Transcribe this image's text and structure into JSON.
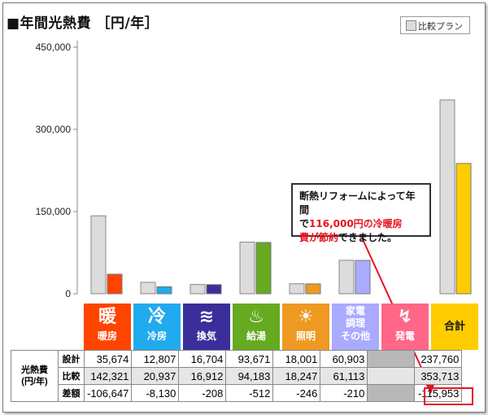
{
  "title": "■年間光熱費 ［円/年］",
  "legend": {
    "label": "比較プラン"
  },
  "chart_data": {
    "type": "bar",
    "title": "■年間光熱費 ［円/年］",
    "ylabel": "",
    "ylim": [
      0,
      450000
    ],
    "yticks": [
      "450,000",
      "300,000",
      "150,000",
      "0"
    ],
    "ytick_values": [
      450000,
      300000,
      150000,
      0
    ],
    "categories": [
      "暖房",
      "冷房",
      "換気",
      "給湯",
      "照明",
      "家電調理その他",
      "発電",
      "合計"
    ],
    "series": [
      {
        "name": "比較プラン",
        "values": [
          142321,
          20937,
          16912,
          94183,
          18247,
          61113,
          0,
          353713
        ]
      },
      {
        "name": "",
        "values": [
          35674,
          12807,
          16704,
          93671,
          18001,
          60903,
          0,
          237760
        ]
      }
    ],
    "colors": {
      "comparison": "#dcdcdc",
      "design": [
        "#ff4400",
        "#22aaee",
        "#3a2f9a",
        "#66aa22",
        "#ee9922",
        "#aaaaff",
        "#ffffff",
        "#ffcc00"
      ]
    },
    "grid": false
  },
  "callout": {
    "line1": "断熱リフォームによって年間",
    "line2a": "で",
    "line2b": "116,000円の冷暖房",
    "line3a": "費が節約",
    "line3b": "できました。"
  },
  "categories_row": [
    {
      "glyph": "暖",
      "label": "暖房",
      "color": "#ff4400",
      "icon": "house-icon"
    },
    {
      "glyph": "冷",
      "label": "冷房",
      "color": "#22aaee",
      "icon": "house-icon"
    },
    {
      "glyph": "≋",
      "label": "換気",
      "color": "#3a2f9a",
      "icon": "wave-icon"
    },
    {
      "glyph": "♨",
      "label": "給湯",
      "color": "#66aa22",
      "icon": "pot-icon"
    },
    {
      "glyph": "☀",
      "label": "照明",
      "color": "#ee9922",
      "icon": "bulb-icon"
    },
    {
      "glyph": "家電\n調理",
      "label": "その他",
      "color": "#aaaaff",
      "icon": "appliance-icon"
    },
    {
      "glyph": "↯",
      "label": "発電",
      "color": "#ff6688",
      "icon": "lightning-icon"
    },
    {
      "glyph": "",
      "label": "合計",
      "color": "#ffcc00",
      "icon": ""
    }
  ],
  "table": {
    "group_label_line1": "光熱費",
    "group_label_line2": "(円/年)",
    "rows": [
      {
        "label": "設計",
        "values": [
          "35,674",
          "12,807",
          "16,704",
          "93,671",
          "18,001",
          "60,903",
          "",
          "237,760"
        ]
      },
      {
        "label": "比較",
        "values": [
          "142,321",
          "20,937",
          "16,912",
          "94,183",
          "18,247",
          "61,113",
          "",
          "353,713"
        ]
      },
      {
        "label": "差額",
        "values": [
          "-106,647",
          "-8,130",
          "-208",
          "-512",
          "-246",
          "-210",
          "",
          "-115,953"
        ]
      }
    ]
  }
}
